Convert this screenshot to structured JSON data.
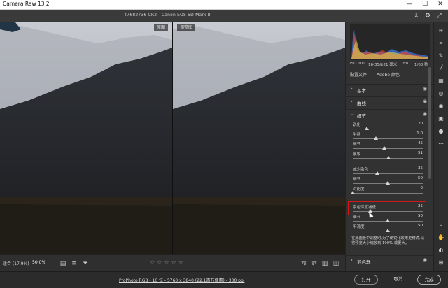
{
  "window": {
    "title": "Camera Raw 13.2",
    "minimize": "—",
    "maximize": "☐",
    "close": "✕"
  },
  "toolbar": {
    "filename": "47682736 CR2 - Canon EOS 5D Mark III"
  },
  "viewer": {
    "before_label": "原图",
    "after_label": "调整图"
  },
  "bottom_bar": {
    "zoom_label": "适合 (17.9%)",
    "zoom_value": "50.0%",
    "stars": "☆☆☆☆☆"
  },
  "footer": {
    "info": "ProPhoto RGB - 16 位 - 5760 x 3840 (22.1百万像素) - 300 ppi",
    "open_button": "打开",
    "cancel_button": "取消",
    "done_button": "完成"
  },
  "panel": {
    "camera_info": [
      "ISO 100",
      "16-35@21 毫米",
      "f/8",
      "1/60 秒"
    ],
    "profile_label": "配置文件",
    "profile_value": "Adobe 颜色",
    "sections": {
      "basic": "基本",
      "curve": "曲线",
      "detail": "细节",
      "mixer": "混色器"
    },
    "sliders": {
      "sharpen": {
        "label": "锐化",
        "value": "20",
        "level": 0.2
      },
      "radius": {
        "label": "半径",
        "value": "1.0",
        "level": 0.33
      },
      "detail": {
        "label": "细节",
        "value": "45",
        "level": 0.45
      },
      "masking": {
        "label": "蒙版",
        "value": "51",
        "level": 0.51
      },
      "noise": {
        "label": "减少杂色",
        "value": "35",
        "level": 0.35
      },
      "noise_detail": {
        "label": "细节",
        "value": "50",
        "level": 0.5
      },
      "contrast": {
        "label": "对比度",
        "value": "0",
        "level": 0.0
      },
      "color_noise": {
        "label": "杂色深度减低",
        "value": "25",
        "level": 0.25
      },
      "color_detail": {
        "label": "细节",
        "value": "50",
        "level": 0.5
      },
      "smoothness": {
        "label": "平滑度",
        "value": "50",
        "level": 0.5
      }
    },
    "help_text": "在此面板中调整时,为了使锐化效果更精确,请将预览大小缩放到 100% 或更大。"
  },
  "colors": {
    "highlight": "#d31818",
    "panel_bg": "#323232",
    "viewer_bg": "#1e1e1e"
  }
}
